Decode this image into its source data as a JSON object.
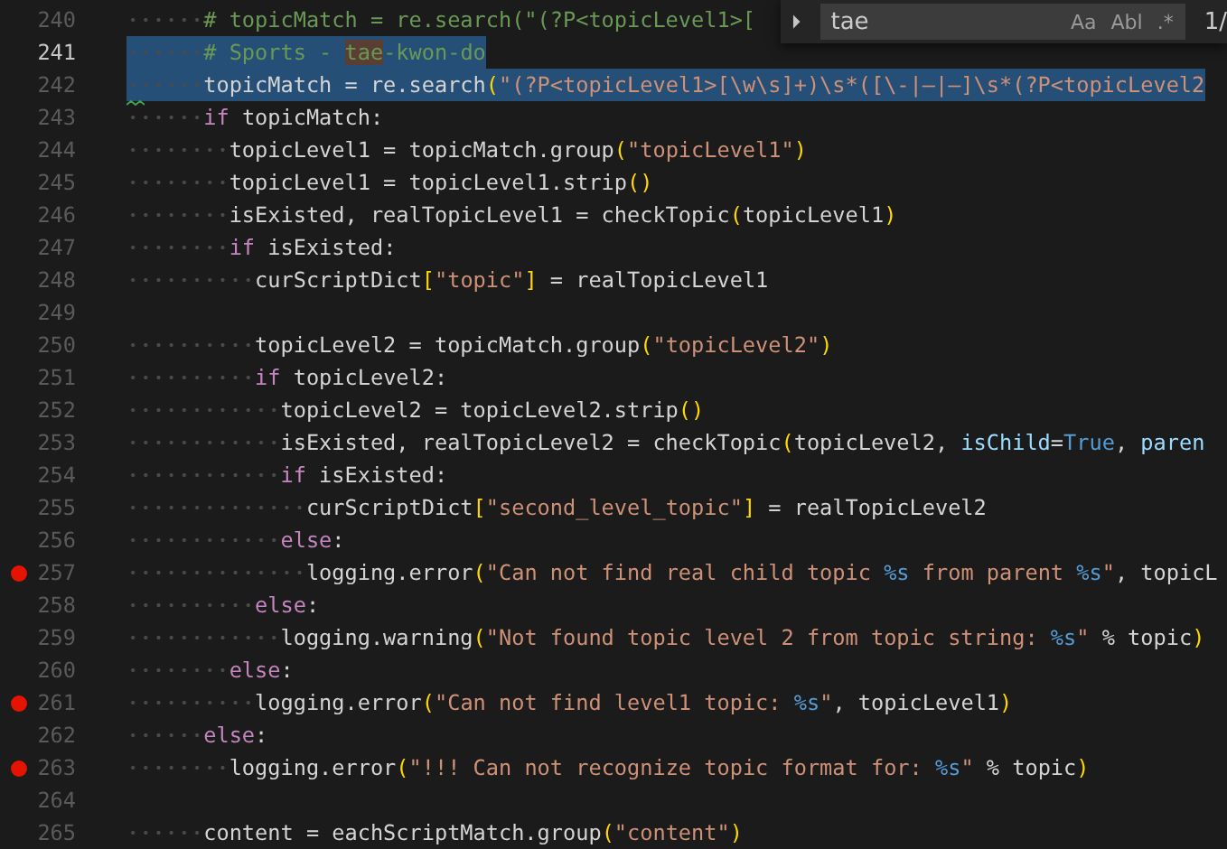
{
  "editor": {
    "lines": [
      {
        "number": "240",
        "selected": false,
        "current": false,
        "breakpoint": false,
        "warning": false,
        "tokens": [
          {
            "kind": "comment",
            "text": "      # topicMatch = re.search(\"(?P<topicLevel1>["
          }
        ]
      },
      {
        "number": "241",
        "selected": true,
        "current": true,
        "breakpoint": false,
        "warning": false,
        "tokens": [
          {
            "kind": "comment",
            "text": "      # Sports - "
          },
          {
            "kind": "match",
            "text": "tae"
          },
          {
            "kind": "comment",
            "text": "-kwon-do"
          }
        ]
      },
      {
        "number": "242",
        "selected": true,
        "current": false,
        "breakpoint": false,
        "warning": true,
        "tokens": [
          {
            "kind": "plain",
            "text": "      topicMatch = re.search"
          },
          {
            "kind": "bracket",
            "text": "("
          },
          {
            "kind": "string",
            "text": "\"(?P<topicLevel1>[\\w\\s]+)\\s*([\\-|—|–]\\s*(?P<topicLevel2"
          }
        ]
      },
      {
        "number": "243",
        "selected": false,
        "current": false,
        "breakpoint": false,
        "warning": false,
        "tokens": [
          {
            "kind": "keyword",
            "text": "      if"
          },
          {
            "kind": "plain",
            "text": " topicMatch:"
          }
        ]
      },
      {
        "number": "244",
        "selected": false,
        "current": false,
        "breakpoint": false,
        "warning": false,
        "tokens": [
          {
            "kind": "plain",
            "text": "        topicLevel1 = topicMatch.group"
          },
          {
            "kind": "bracket",
            "text": "("
          },
          {
            "kind": "string",
            "text": "\"topicLevel1\""
          },
          {
            "kind": "bracket",
            "text": ")"
          }
        ]
      },
      {
        "number": "245",
        "selected": false,
        "current": false,
        "breakpoint": false,
        "warning": false,
        "tokens": [
          {
            "kind": "plain",
            "text": "        topicLevel1 = topicLevel1.strip"
          },
          {
            "kind": "bracket",
            "text": "()"
          }
        ]
      },
      {
        "number": "246",
        "selected": false,
        "current": false,
        "breakpoint": false,
        "warning": false,
        "tokens": [
          {
            "kind": "plain",
            "text": "        isExisted, realTopicLevel1 = checkTopic"
          },
          {
            "kind": "bracket",
            "text": "("
          },
          {
            "kind": "plain",
            "text": "topicLevel1"
          },
          {
            "kind": "bracket",
            "text": ")"
          }
        ]
      },
      {
        "number": "247",
        "selected": false,
        "current": false,
        "breakpoint": false,
        "warning": false,
        "tokens": [
          {
            "kind": "keyword",
            "text": "        if"
          },
          {
            "kind": "plain",
            "text": " isExisted:"
          }
        ]
      },
      {
        "number": "248",
        "selected": false,
        "current": false,
        "breakpoint": false,
        "warning": false,
        "tokens": [
          {
            "kind": "plain",
            "text": "          curScriptDict"
          },
          {
            "kind": "bracket",
            "text": "["
          },
          {
            "kind": "string",
            "text": "\"topic\""
          },
          {
            "kind": "bracket",
            "text": "]"
          },
          {
            "kind": "plain",
            "text": " = realTopicLevel1"
          }
        ]
      },
      {
        "number": "249",
        "current": false,
        "breakpoint": false,
        "warning": false
      },
      {
        "number": "250",
        "selected": false,
        "current": false,
        "breakpoint": false,
        "warning": false,
        "tokens": [
          {
            "kind": "plain",
            "text": "          topicLevel2 = topicMatch.group"
          },
          {
            "kind": "bracket",
            "text": "("
          },
          {
            "kind": "string",
            "text": "\"topicLevel2\""
          },
          {
            "kind": "bracket",
            "text": ")"
          }
        ]
      },
      {
        "number": "251",
        "selected": false,
        "current": false,
        "breakpoint": false,
        "warning": false,
        "tokens": [
          {
            "kind": "keyword",
            "text": "          if"
          },
          {
            "kind": "plain",
            "text": " topicLevel2:"
          }
        ]
      },
      {
        "number": "252",
        "selected": false,
        "current": false,
        "breakpoint": false,
        "warning": false,
        "tokens": [
          {
            "kind": "plain",
            "text": "            topicLevel2 = topicLevel2.strip"
          },
          {
            "kind": "bracket",
            "text": "()"
          }
        ]
      },
      {
        "number": "253",
        "selected": false,
        "current": false,
        "breakpoint": false,
        "warning": false,
        "tokens": [
          {
            "kind": "plain",
            "text": "            isExisted, realTopicLevel2 = checkTopic"
          },
          {
            "kind": "bracket",
            "text": "("
          },
          {
            "kind": "plain",
            "text": "topicLevel2, "
          },
          {
            "kind": "param",
            "text": "isChild"
          },
          {
            "kind": "plain",
            "text": "="
          },
          {
            "kind": "constant",
            "text": "True"
          },
          {
            "kind": "plain",
            "text": ", "
          },
          {
            "kind": "param",
            "text": "paren"
          }
        ]
      },
      {
        "number": "254",
        "selected": false,
        "current": false,
        "breakpoint": false,
        "warning": false,
        "tokens": [
          {
            "kind": "keyword",
            "text": "            if"
          },
          {
            "kind": "plain",
            "text": " isExisted:"
          }
        ]
      },
      {
        "number": "255",
        "selected": false,
        "current": false,
        "breakpoint": false,
        "warning": false,
        "tokens": [
          {
            "kind": "plain",
            "text": "              curScriptDict"
          },
          {
            "kind": "bracket",
            "text": "["
          },
          {
            "kind": "string",
            "text": "\"second_level_topic\""
          },
          {
            "kind": "bracket",
            "text": "]"
          },
          {
            "kind": "plain",
            "text": " = realTopicLevel2"
          }
        ]
      },
      {
        "number": "256",
        "selected": false,
        "current": false,
        "breakpoint": false,
        "warning": false,
        "tokens": [
          {
            "kind": "keyword",
            "text": "            else"
          },
          {
            "kind": "plain",
            "text": ":"
          }
        ]
      },
      {
        "number": "257",
        "selected": false,
        "current": false,
        "breakpoint": true,
        "warning": false,
        "tokens": [
          {
            "kind": "plain",
            "text": "              logging.error"
          },
          {
            "kind": "bracket",
            "text": "("
          },
          {
            "kind": "string",
            "text": "\"Can not find real child topic "
          },
          {
            "kind": "format",
            "text": "%s"
          },
          {
            "kind": "string",
            "text": " from parent "
          },
          {
            "kind": "format",
            "text": "%s"
          },
          {
            "kind": "string",
            "text": "\""
          },
          {
            "kind": "plain",
            "text": ", topicL"
          }
        ]
      },
      {
        "number": "258",
        "selected": false,
        "current": false,
        "breakpoint": false,
        "warning": false,
        "tokens": [
          {
            "kind": "keyword",
            "text": "          else"
          },
          {
            "kind": "plain",
            "text": ":"
          }
        ]
      },
      {
        "number": "259",
        "selected": false,
        "current": false,
        "breakpoint": false,
        "warning": false,
        "tokens": [
          {
            "kind": "plain",
            "text": "            logging.warning"
          },
          {
            "kind": "bracket",
            "text": "("
          },
          {
            "kind": "string",
            "text": "\"Not found topic level 2 from topic string: "
          },
          {
            "kind": "format",
            "text": "%s"
          },
          {
            "kind": "string",
            "text": "\""
          },
          {
            "kind": "plain",
            "text": " % topic"
          },
          {
            "kind": "bracket",
            "text": ")"
          }
        ]
      },
      {
        "number": "260",
        "selected": false,
        "current": false,
        "breakpoint": false,
        "warning": false,
        "tokens": [
          {
            "kind": "keyword",
            "text": "        else"
          },
          {
            "kind": "plain",
            "text": ":"
          }
        ]
      },
      {
        "number": "261",
        "selected": false,
        "current": false,
        "breakpoint": true,
        "warning": false,
        "tokens": [
          {
            "kind": "plain",
            "text": "          logging.error"
          },
          {
            "kind": "bracket",
            "text": "("
          },
          {
            "kind": "string",
            "text": "\"Can not find level1 topic: "
          },
          {
            "kind": "format",
            "text": "%s"
          },
          {
            "kind": "string",
            "text": "\""
          },
          {
            "kind": "plain",
            "text": ", topicLevel1"
          },
          {
            "kind": "bracket",
            "text": ")"
          }
        ]
      },
      {
        "number": "262",
        "selected": false,
        "current": false,
        "breakpoint": false,
        "warning": false,
        "tokens": [
          {
            "kind": "keyword",
            "text": "      else"
          },
          {
            "kind": "plain",
            "text": ":"
          }
        ]
      },
      {
        "number": "263",
        "selected": false,
        "current": false,
        "breakpoint": true,
        "warning": false,
        "tokens": [
          {
            "kind": "plain",
            "text": "        logging.error"
          },
          {
            "kind": "bracket",
            "text": "("
          },
          {
            "kind": "string",
            "text": "\"!!! Can not recognize topic format for: "
          },
          {
            "kind": "format",
            "text": "%s"
          },
          {
            "kind": "string",
            "text": "\""
          },
          {
            "kind": "plain",
            "text": " % topic"
          },
          {
            "kind": "bracket",
            "text": ")"
          }
        ]
      },
      {
        "number": "264",
        "current": false,
        "breakpoint": false,
        "warning": false
      },
      {
        "number": "265",
        "selected": false,
        "current": false,
        "breakpoint": false,
        "warning": false,
        "tokens": [
          {
            "kind": "plain",
            "text": "      content = eachScriptMatch.group"
          },
          {
            "kind": "bracket",
            "text": "("
          },
          {
            "kind": "string",
            "text": "\"content\""
          },
          {
            "kind": "bracket",
            "text": ")"
          }
        ]
      }
    ]
  },
  "find_widget": {
    "value": "tae",
    "options": [
      {
        "label": "Aa",
        "selected": false
      },
      {
        "label": "Abl",
        "selected": false
      },
      {
        "label": ".*",
        "selected": false
      }
    ],
    "count": "1/"
  }
}
